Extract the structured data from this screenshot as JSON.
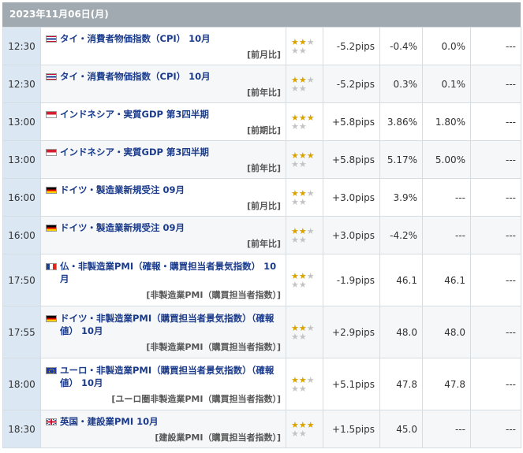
{
  "date_header": "2023年11月06日(月)",
  "rows": [
    {
      "time": "12:30",
      "flag": "th",
      "flag_icon": "thailand-flag-icon",
      "title": "タイ・消費者物価指数（CPI） 10月",
      "sub": "[前月比]",
      "stars": 2,
      "pips": "-5.2pips",
      "actual": "-0.4%",
      "forecast": "0.0%",
      "previous": "---",
      "h": 48,
      "star_offset": 0
    },
    {
      "time": "12:30",
      "flag": "th",
      "flag_icon": "thailand-flag-icon",
      "title": "タイ・消費者物価指数（CPI） 10月",
      "sub": "[前年比]",
      "stars": 2,
      "pips": "-5.2pips",
      "actual": "0.3%",
      "forecast": "0.1%",
      "previous": "---",
      "h": 48,
      "star_offset": 0
    },
    {
      "time": "13:00",
      "flag": "id",
      "flag_icon": "indonesia-flag-icon",
      "title": "インドネシア・実質GDP 第3四半期",
      "sub": "[前期比]",
      "stars": 3,
      "pips": "+5.8pips",
      "actual": "3.86%",
      "forecast": "1.80%",
      "previous": "---",
      "h": 48,
      "star_offset": 0
    },
    {
      "time": "13:00",
      "flag": "id",
      "flag_icon": "indonesia-flag-icon",
      "title": "インドネシア・実質GDP 第3四半期",
      "sub": "[前年比]",
      "stars": 3,
      "pips": "+5.8pips",
      "actual": "5.17%",
      "forecast": "5.00%",
      "previous": "---",
      "h": 48,
      "star_offset": 0
    },
    {
      "time": "16:00",
      "flag": "de",
      "flag_icon": "germany-flag-icon",
      "title": "ドイツ・製造業新規受注 09月",
      "sub": "[前月比]",
      "stars": 2,
      "pips": "+3.0pips",
      "actual": "3.9%",
      "forecast": "---",
      "previous": "---",
      "h": 48,
      "star_offset": 0
    },
    {
      "time": "16:00",
      "flag": "de",
      "flag_icon": "germany-flag-icon",
      "title": "ドイツ・製造業新規受注 09月",
      "sub": "[前年比]",
      "stars": 2,
      "pips": "+3.0pips",
      "actual": "-4.2%",
      "forecast": "---",
      "previous": "---",
      "h": 48,
      "star_offset": 0
    },
    {
      "time": "17:50",
      "flag": "fr",
      "flag_icon": "france-flag-icon",
      "title": "仏・非製造業PMI（確報・購買担当者景気指数） 10月",
      "sub": "[非製造業PMI（購買担当者指数）]",
      "stars": 2,
      "pips": "-1.9pips",
      "actual": "46.1",
      "forecast": "46.1",
      "previous": "---",
      "h": 66,
      "star_offset": 0
    },
    {
      "time": "17:55",
      "flag": "de",
      "flag_icon": "germany-flag-icon",
      "title": "ドイツ・非製造業PMI（購買担当者景気指数）（確報値） 10月",
      "sub": "[非製造業PMI（購買担当者指数）]",
      "stars": 2,
      "pips": "+2.9pips",
      "actual": "48.0",
      "forecast": "48.0",
      "previous": "---",
      "h": 66,
      "star_offset": 0
    },
    {
      "time": "18:00",
      "flag": "eu",
      "flag_icon": "eu-flag-icon",
      "title": "ユーロ・非製造業PMI（購買担当者景気指数）（確報値） 10月",
      "sub": "[ユーロ圏非製造業PMI（購買担当者指数）]",
      "stars": 2,
      "pips": "+5.1pips",
      "actual": "47.8",
      "forecast": "47.8",
      "previous": "---",
      "h": 66,
      "star_offset": 0
    },
    {
      "time": "18:30",
      "flag": "gb",
      "flag_icon": "uk-flag-icon",
      "title": "英国・建設業PMI 10月",
      "sub": "[建設業PMI（購買担当者指数）]",
      "stars": 3,
      "pips": "+1.5pips",
      "actual": "45.0",
      "forecast": "---",
      "previous": "---",
      "h": 48,
      "star_offset": 0
    }
  ]
}
